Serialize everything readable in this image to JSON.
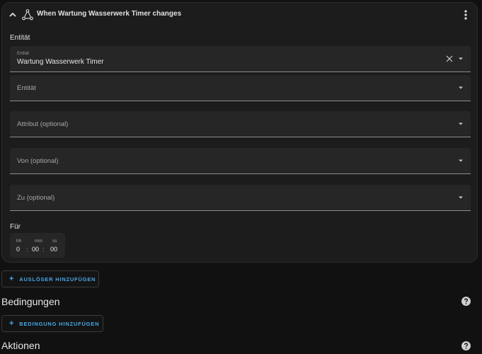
{
  "trigger": {
    "title": "When Wartung Wasserwerk Timer changes",
    "section_entity_label": "Entität",
    "entity_field": {
      "label": "Entität",
      "value": "Wartung Wasserwerk Timer"
    },
    "entity2_field": {
      "placeholder": "Entität"
    },
    "attribute_field": {
      "placeholder": "Attribut (optional)"
    },
    "from_field": {
      "placeholder": "Von (optional)"
    },
    "to_field": {
      "placeholder": "Zu (optional)"
    },
    "duration": {
      "label": "Für",
      "hh_label": "hh",
      "mm_label": "mm",
      "ss_label": "ss",
      "hh": "0",
      "mm": "00",
      "ss": "00",
      "separator": ":"
    }
  },
  "add_trigger_button": {
    "plus": "+",
    "label": "AUSLÖSER HINZUFÜGEN"
  },
  "conditions": {
    "heading": "Bedingungen",
    "add_button_plus": "+",
    "add_button_label": "BEDINGUNG HINZUFÜGEN"
  },
  "actions": {
    "heading": "Aktionen"
  },
  "colors": {
    "accent": "#48a8e8",
    "background": "#111111",
    "card": "#1c1c1c",
    "field": "#262626"
  }
}
